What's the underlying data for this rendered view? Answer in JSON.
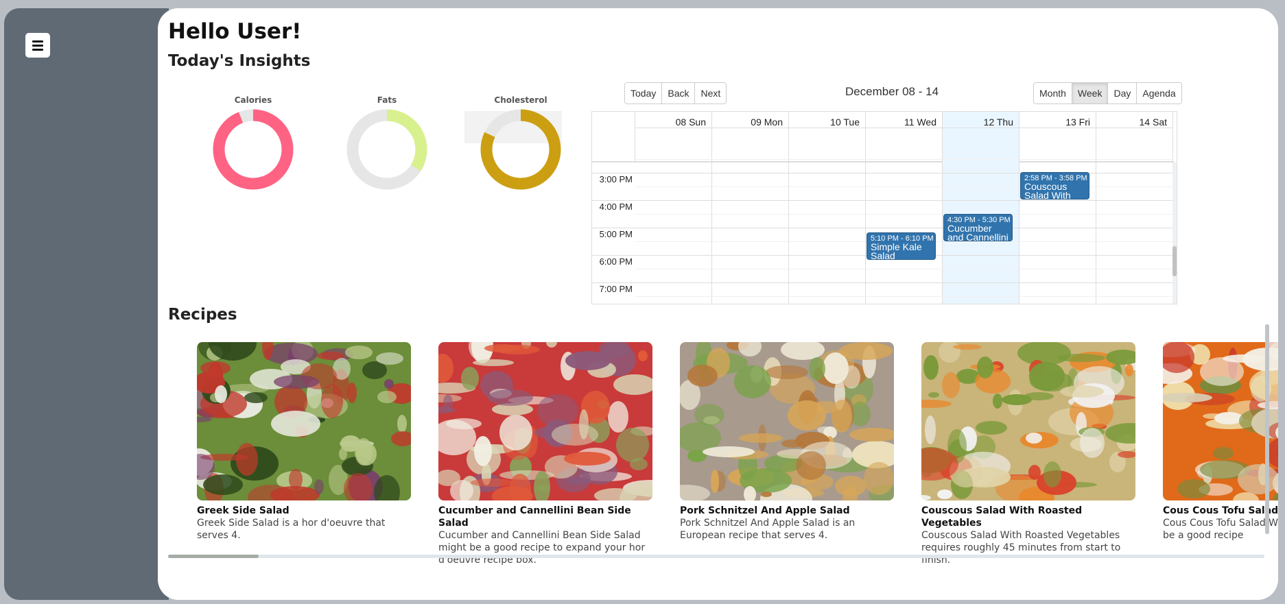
{
  "header": {
    "greeting": "Hello User!",
    "insights_title": "Today's Insights"
  },
  "insights": [
    {
      "label": "Calories",
      "value_fraction": 0.94,
      "color": "#ff6384"
    },
    {
      "label": "Fats",
      "value_fraction": 0.34,
      "color": "#d9f08e"
    },
    {
      "label": "Cholesterol",
      "value_fraction": 0.82,
      "color": "#cc9f12"
    }
  ],
  "calendar": {
    "nav": {
      "today": "Today",
      "back": "Back",
      "next": "Next"
    },
    "range_label": "December 08 - 14",
    "views": {
      "month": "Month",
      "week": "Week",
      "day": "Day",
      "agenda": "Agenda",
      "active": "Week"
    },
    "days": [
      "08 Sun",
      "09 Mon",
      "10 Tue",
      "11 Wed",
      "12 Thu",
      "13 Fri",
      "14 Sat"
    ],
    "today": "12 Thu",
    "times": [
      "3:00 PM",
      "4:00 PM",
      "5:00 PM",
      "6:00 PM",
      "7:00 PM"
    ],
    "events": [
      {
        "day": "13 Fri",
        "time": "2:58 PM - 3:58 PM",
        "title": "Couscous Salad With Roasted Vegetables"
      },
      {
        "day": "12 Thu",
        "time": "4:30 PM - 5:30 PM",
        "title": "Cucumber and Cannellini Bean Side Salad"
      },
      {
        "day": "11 Wed",
        "time": "5:10 PM - 6:10 PM",
        "title": "Simple Kale Salad"
      }
    ]
  },
  "recipes": {
    "title": "Recipes",
    "items": [
      {
        "name": "Greek Side Salad",
        "description": "Greek Side Salad is a hor d'oeuvre that serves 4."
      },
      {
        "name": "Cucumber and Cannellini Bean Side Salad",
        "description": "Cucumber and Cannellini Bean Side Salad might be a good recipe to expand your hor d'oeuvre recipe box."
      },
      {
        "name": "Pork Schnitzel And Apple Salad",
        "description": "Pork Schnitzel And Apple Salad is an European recipe that serves 4."
      },
      {
        "name": "Couscous Salad With Roasted Vegetables",
        "description": "Couscous Salad With Roasted Vegetables requires roughly 45 minutes from start to finish."
      },
      {
        "name": "Cous Cous Tofu Salad With Dressing",
        "description": "Cous Cous Tofu Salad With Dressing might be a good recipe"
      }
    ]
  },
  "icons": {
    "menu": "hamburger-menu-icon"
  }
}
